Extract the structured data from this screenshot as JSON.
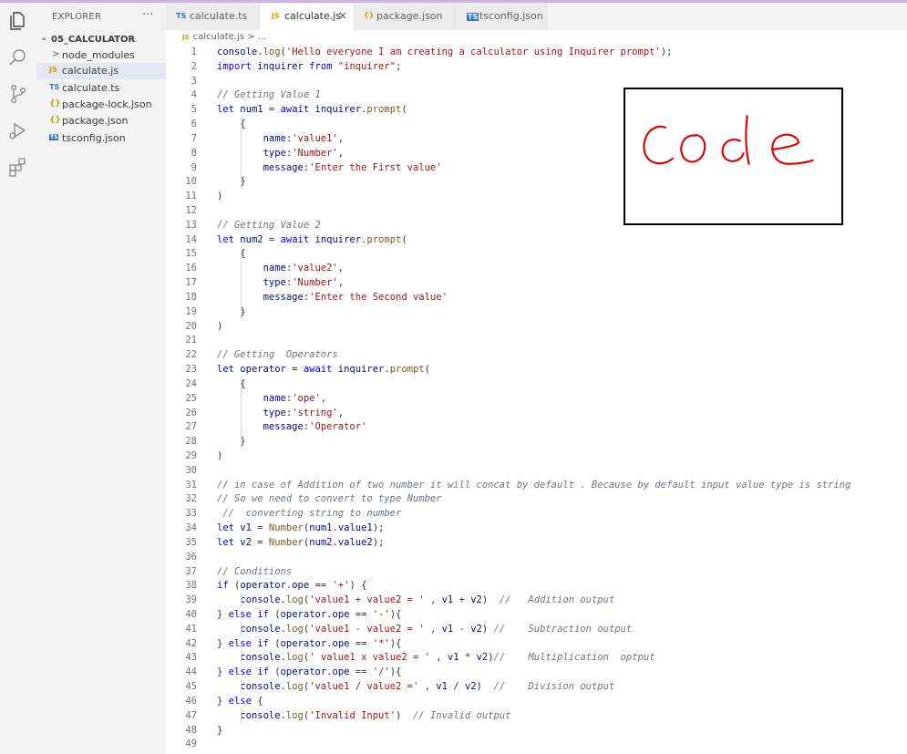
{
  "sidebar": {
    "title": "EXPLORER",
    "more": "···",
    "folder": "05_CALCULATOR",
    "items": [
      {
        "label": "node_modules",
        "icon": "chevron-right-icon",
        "iconText": ">"
      },
      {
        "label": "calculate.js",
        "icon": "js-file-icon",
        "iconText": "JS"
      },
      {
        "label": "calculate.ts",
        "icon": "ts-file-icon",
        "iconText": "TS"
      },
      {
        "label": "package-lock.json",
        "icon": "json-file-icon",
        "iconText": "{}"
      },
      {
        "label": "package.json",
        "icon": "json-file-icon",
        "iconText": "{}"
      },
      {
        "label": "tsconfig.json",
        "icon": "tsconfig-file-icon",
        "iconText": "TS"
      }
    ]
  },
  "tabs": [
    {
      "label": "calculate.ts",
      "icon": "TS"
    },
    {
      "label": "calculate.js",
      "icon": "JS",
      "close": "×"
    },
    {
      "label": "package.json",
      "icon": "{}"
    },
    {
      "label": "tsconfig.json",
      "icon": "TS"
    }
  ],
  "breadcrumb": {
    "icon": "JS",
    "text": "calculate.js > ..."
  },
  "annotation": "Code",
  "code_lines": [
    {
      "n": "1",
      "text": "console.log('Hello everyone I am creating a calculator using Inquirer prompt');"
    },
    {
      "n": "2",
      "text": "import inquirer from \"inquirer\";"
    },
    {
      "n": "3",
      "text": ""
    },
    {
      "n": "4",
      "text": "// Getting Value 1"
    },
    {
      "n": "5",
      "text": "let num1 = await inquirer.prompt("
    },
    {
      "n": "6",
      "text": "    {"
    },
    {
      "n": "7",
      "text": "        name:'value1',"
    },
    {
      "n": "8",
      "text": "        type:'Number',"
    },
    {
      "n": "9",
      "text": "        message:'Enter the First value'"
    },
    {
      "n": "10",
      "text": "    }"
    },
    {
      "n": "11",
      "text": ")"
    },
    {
      "n": "12",
      "text": ""
    },
    {
      "n": "13",
      "text": "// Getting Value 2"
    },
    {
      "n": "14",
      "text": "let num2 = await inquirer.prompt("
    },
    {
      "n": "15",
      "text": "    {"
    },
    {
      "n": "16",
      "text": "        name:'value2',"
    },
    {
      "n": "17",
      "text": "        type:'Number',"
    },
    {
      "n": "18",
      "text": "        message:'Enter the Second value'"
    },
    {
      "n": "19",
      "text": "    }"
    },
    {
      "n": "20",
      "text": ")"
    },
    {
      "n": "21",
      "text": ""
    },
    {
      "n": "22",
      "text": "// Getting  Operators"
    },
    {
      "n": "23",
      "text": "let operator = await inquirer.prompt("
    },
    {
      "n": "24",
      "text": "    {"
    },
    {
      "n": "25",
      "text": "        name:'ope',"
    },
    {
      "n": "26",
      "text": "        type:'string',"
    },
    {
      "n": "27",
      "text": "        message:'Operator'"
    },
    {
      "n": "28",
      "text": "    }"
    },
    {
      "n": "29",
      "text": ")"
    },
    {
      "n": "30",
      "text": ""
    },
    {
      "n": "31",
      "text": "// in case of Addition of two number it will concat by default . Because by default input value type is string"
    },
    {
      "n": "32",
      "text": "// So we need to convert to type Number"
    },
    {
      "n": "33",
      "text": " //  converting string to number"
    },
    {
      "n": "34",
      "text": "let v1 = Number(num1.value1);"
    },
    {
      "n": "35",
      "text": "let v2 = Number(num2.value2);"
    },
    {
      "n": "36",
      "text": ""
    },
    {
      "n": "37",
      "text": "// Conditions"
    },
    {
      "n": "38",
      "text": "if (operator.ope == '+') {"
    },
    {
      "n": "39",
      "text": "    console.log('value1 + value2 = ' , v1 + v2)  //   Addition output"
    },
    {
      "n": "40",
      "text": "} else if (operator.ope == '-'){"
    },
    {
      "n": "41",
      "text": "    console.log('value1 - value2 = ' , v1 - v2) //    Subtraction output"
    },
    {
      "n": "42",
      "text": "} else if (operator.ope == '*'){"
    },
    {
      "n": "43",
      "text": "    console.log(' value1 x value2 = ' , v1 * v2)//    Multiplication  optput"
    },
    {
      "n": "44",
      "text": "} else if (operator.ope == '/'){"
    },
    {
      "n": "45",
      "text": "    console.log('value1 / value2 =' , v1 / v2)  //    Division output"
    },
    {
      "n": "46",
      "text": "} else {"
    },
    {
      "n": "47",
      "text": "    console.log('Invalid Input')  // Invalid output"
    },
    {
      "n": "48",
      "text": "}"
    },
    {
      "n": "49",
      "text": ""
    }
  ]
}
